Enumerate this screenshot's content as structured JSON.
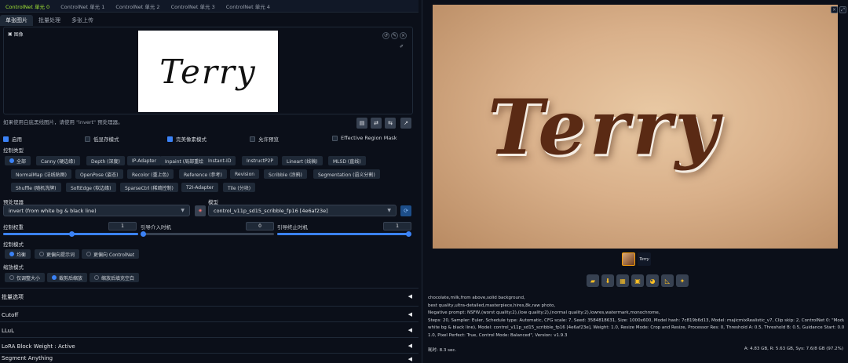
{
  "cn_tabs": [
    "ControlNet 单元 0",
    "ControlNet 单元 1",
    "ControlNet 单元 2",
    "ControlNet 单元 3",
    "ControlNet 单元 4"
  ],
  "sub_tabs": [
    "单张图片",
    "批量处理",
    "多张上传"
  ],
  "image_label": "图像",
  "image_text": "Terry",
  "note": "如果使用白底黑线图片，请使用 \"invert\" 预处理器。",
  "checkboxes": {
    "enable": "启用",
    "low_vram": "低显存模式",
    "pixel_perfect": "完美像素模式",
    "allow_preview": "允许预览",
    "effective_region_mask": "Effective Region Mask"
  },
  "control_type_label": "控制类型",
  "control_types": [
    "全部",
    "Canny (硬边缘)",
    "Depth (深度)",
    "IP-Adapter",
    "Inpaint (局部重绘)",
    "Instant-ID",
    "InstructP2P",
    "Lineart (线稿)",
    "MLSD (直线)",
    "NormalMap (法线贴图)",
    "OpenPose (姿态)",
    "Recolor (重上色)",
    "Reference (参考)",
    "Revision",
    "Scribble (涂鸦)",
    "Segmentation (语义分割)",
    "Shuffle (随机洗牌)",
    "SoftEdge (软边缘)",
    "SparseCtrl (稀疏控制)",
    "T2I-Adapter",
    "Tile (分块)"
  ],
  "preprocessor_label": "预处理器",
  "preprocessor_value": "invert (from white bg & black line)",
  "model_label": "模型",
  "model_value": "control_v11p_sd15_scribble_fp16 [4e6af23e]",
  "weight_label": "控制权重",
  "weight_value": "1",
  "start_label": "引导介入时机",
  "start_value": "0",
  "end_label": "引导终止时机",
  "end_value": "1",
  "sliders": {
    "weight": 1.0,
    "start": 0.0,
    "end": 1.0
  },
  "control_mode_label": "控制模式",
  "control_modes": [
    "均衡",
    "更偏向提示词",
    "更偏向 ControlNet"
  ],
  "resize_label": "缩放模式",
  "resize_modes": [
    "仅调整大小",
    "裁剪后缩放",
    "缩放后填充空白"
  ],
  "accordions": [
    "批量选项",
    "Cutoff",
    "LLuL",
    "LoRA Block Weight : Active",
    "Segment Anything"
  ],
  "output_image_text": "Terry",
  "output_toolbar_icons": [
    "folder-icon",
    "save-icon",
    "zip-icon",
    "image-icon",
    "palette-icon",
    "ruler-icon",
    "sparkle-icon"
  ],
  "info_lines": [
    "chocolate,milk,from above,solid background,",
    "best quality,ultra-detailed,masterpiece,hires,8k,raw photo,",
    "Negative prompt: NSFW,(worst quality:2),(low quality:2),(normal quality:2),lowres,watermark,monochrome,",
    "Steps: 20, Sampler: Euler, Schedule type: Automatic, CFG scale: 7, Seed: 3584818631, Size: 1000x600, Model hash: 7c819b6d13, Model: majicmixRealistic_v7, Clip skip: 2, ControlNet 0: \"Module: invert (from",
    "white bg & black line), Model: control_v11p_sd15_scribble_fp16 [4e6af23e], Weight: 1.0, Resize Mode: Crop and Resize, Processor Res: 0, Threshold A: 0.5, Threshold B: 0.5, Guidance Start: 0.0, Guidance End:",
    "1.0, Pixel Perfect: True, Control Mode: Balanced\", Version: v1.9.3"
  ],
  "time_taken": "耗时: 8.3 sec.",
  "vram": "A: 4.83 GB, R: 5.63 GB, Sys: 7.6/8 GB (97.2%)"
}
